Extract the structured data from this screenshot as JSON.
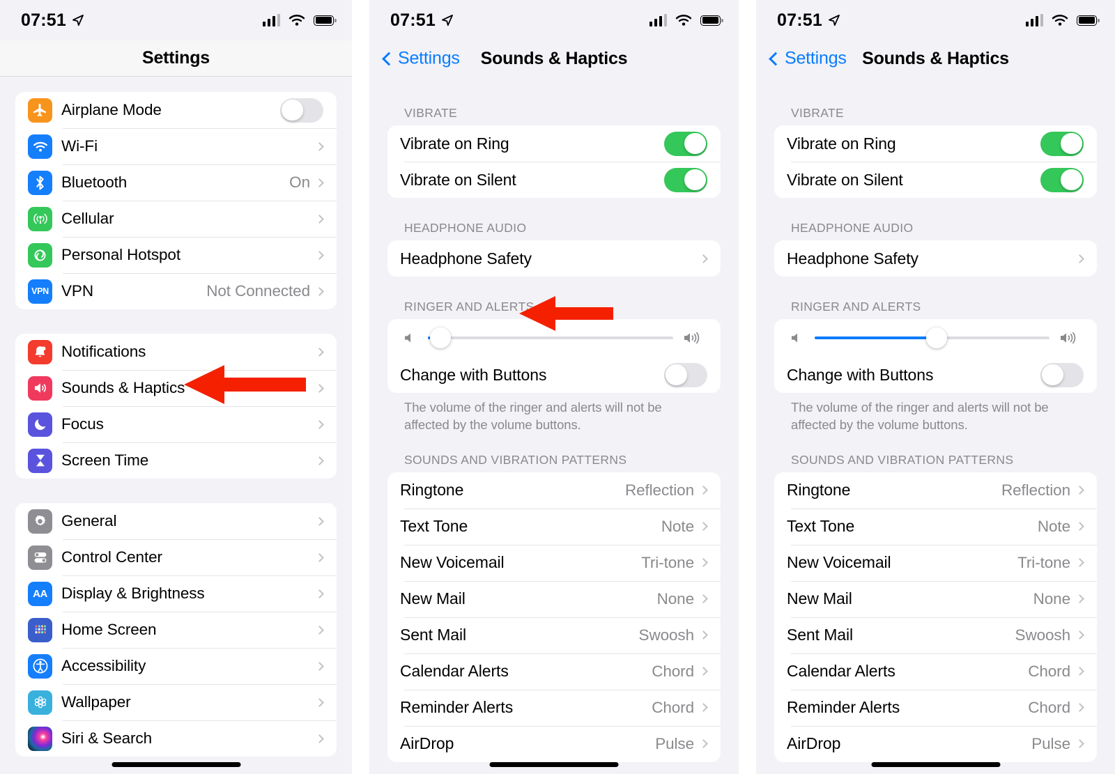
{
  "colors": {
    "accent_blue": "#0a7cff",
    "toggle_green": "#34c759",
    "annotation_red": "#f42000",
    "screen_bg": "#f2f2f7",
    "card_white": "#ffffff",
    "secondary_text": "#8a8a8e"
  },
  "status_bar": {
    "time": "07:51",
    "location_icon": "location-arrow-icon",
    "signal_icon": "cellular-signal-icon",
    "wifi_icon": "wifi-icon",
    "battery_icon": "battery-icon"
  },
  "panel1": {
    "nav": {
      "title": "Settings"
    },
    "group1": [
      {
        "label": "Airplane Mode",
        "icon": "airplane-icon",
        "icon_color": "#f7941d",
        "control": "toggle",
        "toggle_on": false
      },
      {
        "label": "Wi-Fi",
        "icon": "wifi-icon",
        "icon_color": "#157efb",
        "control": "chevron",
        "value": ""
      },
      {
        "label": "Bluetooth",
        "icon": "bluetooth-icon",
        "icon_color": "#157efb",
        "control": "chevron",
        "value": "On"
      },
      {
        "label": "Cellular",
        "icon": "cellular-icon",
        "icon_color": "#34c759",
        "control": "chevron",
        "value": ""
      },
      {
        "label": "Personal Hotspot",
        "icon": "hotspot-icon",
        "icon_color": "#34c759",
        "control": "chevron",
        "value": ""
      },
      {
        "label": "VPN",
        "icon": "vpn-icon",
        "icon_color": "#157efb",
        "control": "chevron",
        "value": "Not Connected"
      }
    ],
    "group2": [
      {
        "label": "Notifications",
        "icon": "notifications-bell-icon",
        "icon_color": "#f33b2e",
        "control": "chevron",
        "value": ""
      },
      {
        "label": "Sounds & Haptics",
        "icon": "speaker-waves-icon",
        "icon_color": "#ef3a5e",
        "control": "chevron",
        "value": ""
      },
      {
        "label": "Focus",
        "icon": "moon-icon",
        "icon_color": "#5a53de",
        "control": "chevron",
        "value": ""
      },
      {
        "label": "Screen Time",
        "icon": "hourglass-icon",
        "icon_color": "#5a53de",
        "control": "chevron",
        "value": ""
      }
    ],
    "group3": [
      {
        "label": "General",
        "icon": "gear-icon",
        "icon_color": "#8e8e93",
        "control": "chevron",
        "value": ""
      },
      {
        "label": "Control Center",
        "icon": "control-center-icon",
        "icon_color": "#8e8e93",
        "control": "chevron",
        "value": ""
      },
      {
        "label": "Display & Brightness",
        "icon": "display-brightness-aa-icon",
        "icon_color": "#157efb",
        "control": "chevron",
        "value": ""
      },
      {
        "label": "Home Screen",
        "icon": "home-screen-grid-icon",
        "icon_color": "#3a5ecb",
        "control": "chevron",
        "value": ""
      },
      {
        "label": "Accessibility",
        "icon": "accessibility-icon",
        "icon_color": "#157efb",
        "control": "chevron",
        "value": ""
      },
      {
        "label": "Wallpaper",
        "icon": "wallpaper-flower-icon",
        "icon_color": "#3ab0dd",
        "control": "chevron",
        "value": ""
      },
      {
        "label": "Siri & Search",
        "icon": "siri-icon",
        "icon_color": "#2b1022",
        "control": "chevron",
        "value": ""
      }
    ],
    "annotation": {
      "type": "arrow-left",
      "target": "Sounds & Haptics"
    }
  },
  "panel2": {
    "nav": {
      "back_label": "Settings",
      "title": "Sounds & Haptics"
    },
    "sections": {
      "vibrate_header": "VIBRATE",
      "vibrate_rows": [
        {
          "label": "Vibrate on Ring",
          "toggle_on": true
        },
        {
          "label": "Vibrate on Silent",
          "toggle_on": true
        }
      ],
      "headphone_header": "HEADPHONE AUDIO",
      "headphone_rows": [
        {
          "label": "Headphone Safety"
        }
      ],
      "ringer_header": "RINGER AND ALERTS",
      "ringer_volume_percent": 5,
      "change_with_buttons_label": "Change with Buttons",
      "change_with_buttons_on": false,
      "footnote": "The volume of the ringer and alerts will not be affected by the volume buttons.",
      "patterns_header": "SOUNDS AND VIBRATION PATTERNS",
      "patterns": [
        {
          "label": "Ringtone",
          "value": "Reflection"
        },
        {
          "label": "Text Tone",
          "value": "Note"
        },
        {
          "label": "New Voicemail",
          "value": "Tri-tone"
        },
        {
          "label": "New Mail",
          "value": "None"
        },
        {
          "label": "Sent Mail",
          "value": "Swoosh"
        },
        {
          "label": "Calendar Alerts",
          "value": "Chord"
        },
        {
          "label": "Reminder Alerts",
          "value": "Chord"
        },
        {
          "label": "AirDrop",
          "value": "Pulse"
        }
      ]
    },
    "annotation": {
      "type": "arrow-left",
      "target": "RINGER AND ALERTS"
    }
  },
  "panel3": {
    "nav": {
      "back_label": "Settings",
      "title": "Sounds & Haptics"
    },
    "sections": {
      "vibrate_header": "VIBRATE",
      "vibrate_rows": [
        {
          "label": "Vibrate on Ring",
          "toggle_on": true
        },
        {
          "label": "Vibrate on Silent",
          "toggle_on": true
        }
      ],
      "headphone_header": "HEADPHONE AUDIO",
      "headphone_rows": [
        {
          "label": "Headphone Safety"
        }
      ],
      "ringer_header": "RINGER AND ALERTS",
      "ringer_volume_percent": 52,
      "change_with_buttons_label": "Change with Buttons",
      "change_with_buttons_on": false,
      "footnote": "The volume of the ringer and alerts will not be affected by the volume buttons.",
      "patterns_header": "SOUNDS AND VIBRATION PATTERNS",
      "patterns": [
        {
          "label": "Ringtone",
          "value": "Reflection"
        },
        {
          "label": "Text Tone",
          "value": "Note"
        },
        {
          "label": "New Voicemail",
          "value": "Tri-tone"
        },
        {
          "label": "New Mail",
          "value": "None"
        },
        {
          "label": "Sent Mail",
          "value": "Swoosh"
        },
        {
          "label": "Calendar Alerts",
          "value": "Chord"
        },
        {
          "label": "Reminder Alerts",
          "value": "Chord"
        },
        {
          "label": "AirDrop",
          "value": "Pulse"
        }
      ]
    },
    "annotation": {
      "type": "arrow-down",
      "target": "ringer volume slider"
    }
  }
}
